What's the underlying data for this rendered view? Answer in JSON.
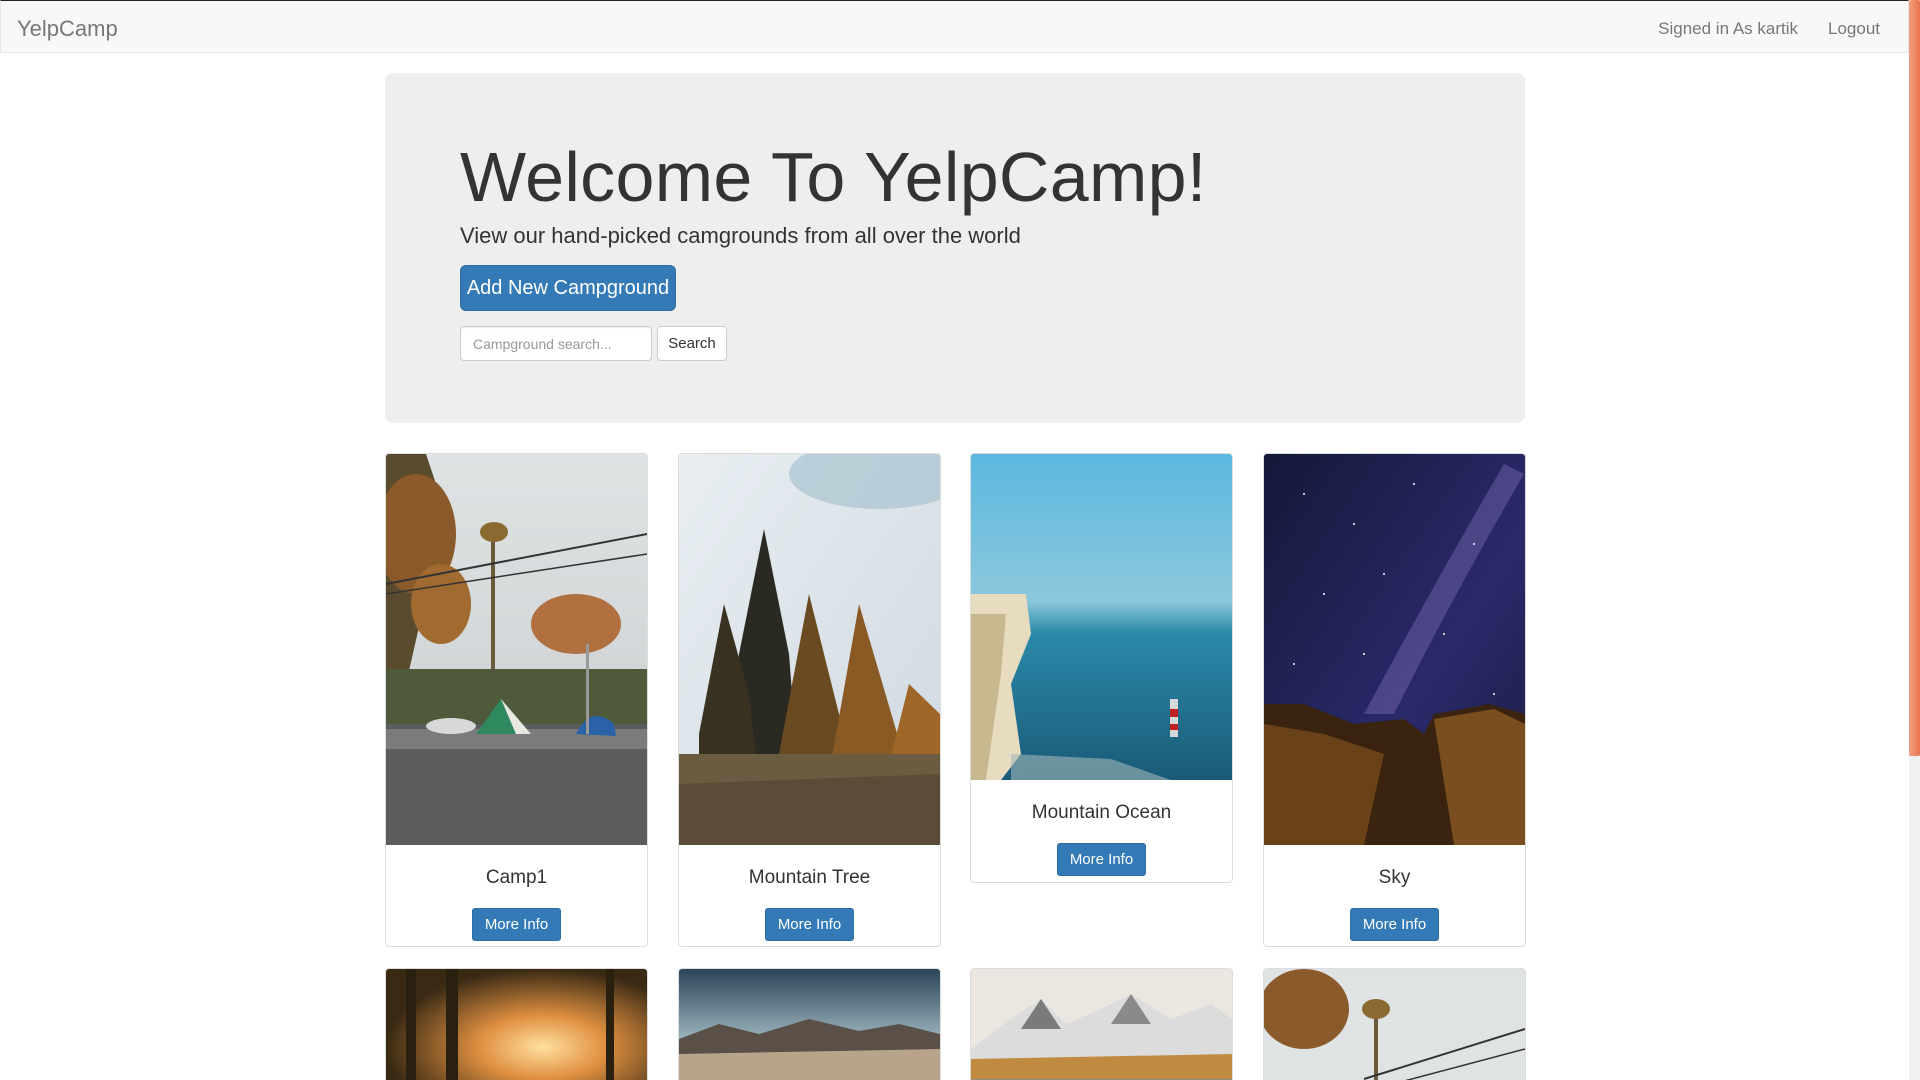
{
  "nav": {
    "brand": "YelpCamp",
    "signed_in": "Signed in As kartik",
    "logout": "Logout"
  },
  "hero": {
    "title": "Welcome To YelpCamp!",
    "subtitle": "View our hand-picked camgrounds from all over the world",
    "add_button": "Add New Campground",
    "search_placeholder": "Campground search...",
    "search_button": "Search"
  },
  "campgrounds": [
    {
      "name": "Camp1",
      "button": "More Info"
    },
    {
      "name": "Mountain Tree",
      "button": "More Info"
    },
    {
      "name": "Mountain Ocean",
      "button": "More Info"
    },
    {
      "name": "Sky",
      "button": "More Info"
    }
  ],
  "colors": {
    "primary": "#337ab7",
    "navbar_bg": "#f8f8f8",
    "jumbotron_bg": "#eeeeee",
    "scroll_accent": "#e8734f"
  }
}
